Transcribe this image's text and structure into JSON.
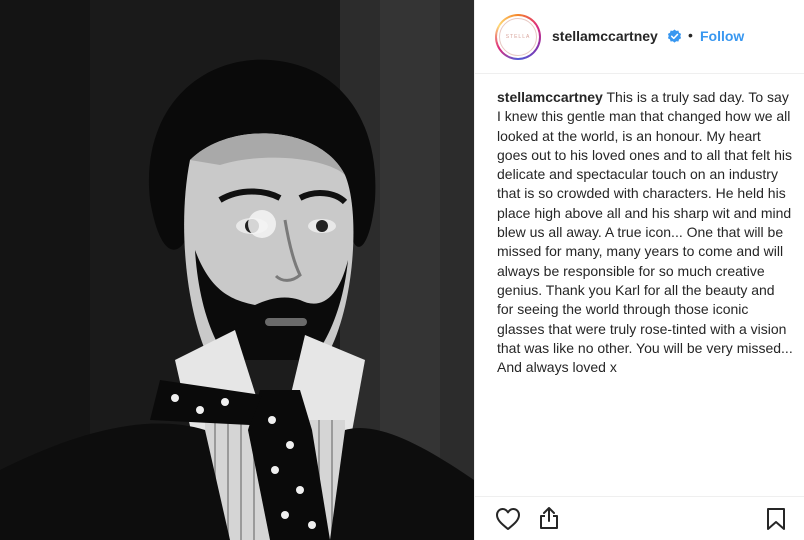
{
  "post": {
    "account": {
      "username": "stellamccartney",
      "verified": true,
      "follow_label": "Follow",
      "separator": "•",
      "avatar_logo_text": "STELLA"
    },
    "caption": {
      "username": "stellamccartney",
      "text": "This is a truly sad day. To say I knew this gentle man that changed how we all looked at the world, is an honour. My heart goes out to his loved ones and to all that felt his delicate and spectacular touch on an industry that is so crowded with characters. He held his place high above all and his sharp wit and mind blew us all away. A true icon... One that will be missed for many, many years to come and will always be responsible for so much creative genius. Thank you Karl for all the beauty and for seeing the world through those iconic glasses that were truly rose-tinted with a vision that was like no other. You will be very missed... And always loved x"
    },
    "actions": {
      "icons": [
        "heart-icon",
        "share-icon",
        "bookmark-icon"
      ]
    },
    "colors": {
      "accent": "#3897f0",
      "text": "#262626",
      "divider": "#efefef"
    }
  }
}
